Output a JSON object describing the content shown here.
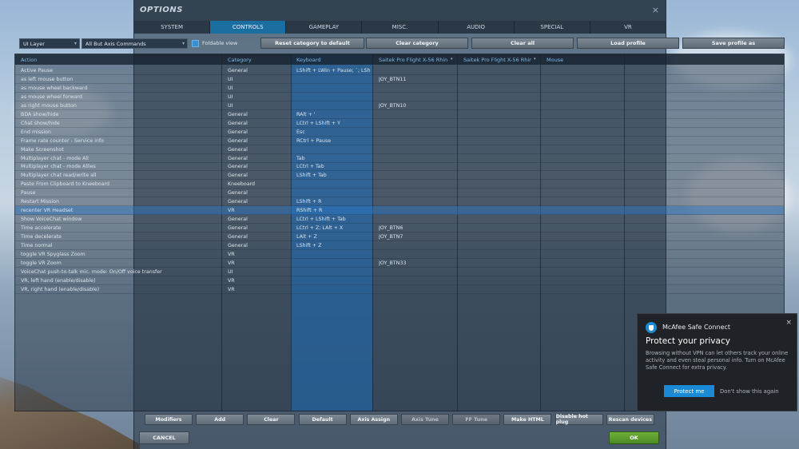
{
  "window": {
    "title": "OPTIONS",
    "close": "×"
  },
  "tabs": [
    {
      "label": "SYSTEM",
      "active": false
    },
    {
      "label": "CONTROLS",
      "active": true
    },
    {
      "label": "GAMEPLAY",
      "active": false
    },
    {
      "label": "MISC.",
      "active": false
    },
    {
      "label": "AUDIO",
      "active": false
    },
    {
      "label": "SPECIAL",
      "active": false
    },
    {
      "label": "VR",
      "active": false
    }
  ],
  "toolbar": {
    "layer_select": "UI Layer",
    "filter_select": "All But Axis Commands",
    "foldable_label": "Foldable view",
    "foldable_checked": true,
    "buttons": [
      "Reset category to default",
      "Clear category",
      "Clear all",
      "Load profile",
      "Save profile as"
    ]
  },
  "grid": {
    "headers": [
      "Action",
      "Category",
      "Keyboard",
      "Saitek Pro Flight X-56 Rhin...",
      "Saitek Pro Flight X-56 Rhin...",
      "Mouse"
    ],
    "rows": [
      {
        "action": "Active Pause",
        "category": "General",
        "keyboard": "LShift + LWin + Pause; `; LShift",
        "joy1": "",
        "joy2": "",
        "mouse": ""
      },
      {
        "action": "as left mouse button",
        "category": "UI",
        "keyboard": "",
        "joy1": "JOY_BTN11",
        "joy2": "",
        "mouse": ""
      },
      {
        "action": "as mouse wheel backward",
        "category": "UI",
        "keyboard": "",
        "joy1": "",
        "joy2": "",
        "mouse": ""
      },
      {
        "action": "as mouse wheel forward",
        "category": "UI",
        "keyboard": "",
        "joy1": "",
        "joy2": "",
        "mouse": ""
      },
      {
        "action": "as right mouse button",
        "category": "UI",
        "keyboard": "",
        "joy1": "JOY_BTN10",
        "joy2": "",
        "mouse": ""
      },
      {
        "action": "BDA show/hide",
        "category": "General",
        "keyboard": "RAlt + '",
        "joy1": "",
        "joy2": "",
        "mouse": ""
      },
      {
        "action": "Chat show/hide",
        "category": "General",
        "keyboard": "LCtrl + LShift + Y",
        "joy1": "",
        "joy2": "",
        "mouse": ""
      },
      {
        "action": "End mission",
        "category": "General",
        "keyboard": "Esc",
        "joy1": "",
        "joy2": "",
        "mouse": ""
      },
      {
        "action": "Frame rate counter - Service info",
        "category": "General",
        "keyboard": "RCtrl + Pause",
        "joy1": "",
        "joy2": "",
        "mouse": ""
      },
      {
        "action": "Make Screenshot",
        "category": "General",
        "keyboard": "",
        "joy1": "",
        "joy2": "",
        "mouse": ""
      },
      {
        "action": "Multiplayer chat - mode All",
        "category": "General",
        "keyboard": "Tab",
        "joy1": "",
        "joy2": "",
        "mouse": ""
      },
      {
        "action": "Multiplayer chat - mode Allies",
        "category": "General",
        "keyboard": "LCtrl + Tab",
        "joy1": "",
        "joy2": "",
        "mouse": ""
      },
      {
        "action": "Multiplayer chat read/write all",
        "category": "General",
        "keyboard": "LShift + Tab",
        "joy1": "",
        "joy2": "",
        "mouse": ""
      },
      {
        "action": "Paste From Clipboard to Kneeboard",
        "category": "Kneeboard",
        "keyboard": "",
        "joy1": "",
        "joy2": "",
        "mouse": ""
      },
      {
        "action": "Pause",
        "category": "General",
        "keyboard": "",
        "joy1": "",
        "joy2": "",
        "mouse": ""
      },
      {
        "action": "Restart Mission",
        "category": "General",
        "keyboard": "LShift + R",
        "joy1": "",
        "joy2": "",
        "mouse": ""
      },
      {
        "action": "recenter VR Headset",
        "category": "VR",
        "keyboard": "RShift + R",
        "joy1": "",
        "joy2": "",
        "mouse": "",
        "selected": true
      },
      {
        "action": "Show VoiceChat window",
        "category": "General",
        "keyboard": "LCtrl + LShift + Tab",
        "joy1": "",
        "joy2": "",
        "mouse": ""
      },
      {
        "action": "Time accelerate",
        "category": "General",
        "keyboard": "LCtrl + Z; LAlt + X",
        "joy1": "JOY_BTN6",
        "joy2": "",
        "mouse": ""
      },
      {
        "action": "Time decelerate",
        "category": "General",
        "keyboard": "LAlt + Z",
        "joy1": "JOY_BTN7",
        "joy2": "",
        "mouse": ""
      },
      {
        "action": "Time normal",
        "category": "General",
        "keyboard": "LShift + Z",
        "joy1": "",
        "joy2": "",
        "mouse": ""
      },
      {
        "action": "toggle VR Spyglass Zoom",
        "category": "VR",
        "keyboard": "",
        "joy1": "",
        "joy2": "",
        "mouse": ""
      },
      {
        "action": "toggle VR Zoom",
        "category": "VR",
        "keyboard": "",
        "joy1": "JOY_BTN33",
        "joy2": "",
        "mouse": ""
      },
      {
        "action": "VoiceChat push-to-talk mic. mode: On/Off voice transfer",
        "category": "UI",
        "keyboard": "",
        "joy1": "",
        "joy2": "",
        "mouse": ""
      },
      {
        "action": "VR, left hand (enable/disable)",
        "category": "VR",
        "keyboard": "",
        "joy1": "",
        "joy2": "",
        "mouse": ""
      },
      {
        "action": "VR, right hand (enable/disable)",
        "category": "VR",
        "keyboard": "",
        "joy1": "",
        "joy2": "",
        "mouse": ""
      }
    ]
  },
  "bottom_buttons": [
    {
      "label": "Modifiers",
      "enabled": true
    },
    {
      "label": "Add",
      "enabled": true
    },
    {
      "label": "Clear",
      "enabled": true
    },
    {
      "label": "Default",
      "enabled": true
    },
    {
      "label": "Axis Assign",
      "enabled": true
    },
    {
      "label": "Axis Tune",
      "enabled": false
    },
    {
      "label": "FF Tune",
      "enabled": false
    },
    {
      "label": "Make HTML",
      "enabled": true
    },
    {
      "label": "Disable hot plug",
      "enabled": true
    },
    {
      "label": "Rescan devices",
      "enabled": true
    }
  ],
  "footer": {
    "cancel": "CANCEL",
    "ok": "OK"
  },
  "popup": {
    "app_name": "McAfee Safe Connect",
    "title": "Protect your privacy",
    "body": "Browsing without VPN can let others track your online activity and even steal personal info. Turn on McAfee Safe Connect for extra privacy.",
    "primary": "Protect me",
    "secondary": "Don't show this again",
    "close": "×"
  },
  "colors": {
    "accent": "#1a6fa0",
    "ok": "#5c9e2c",
    "popup_button": "#1a8ad6"
  },
  "icons": [
    "dropdown-arrow-icon",
    "checkbox-icon",
    "close-icon",
    "mcafee-shield-icon"
  ]
}
